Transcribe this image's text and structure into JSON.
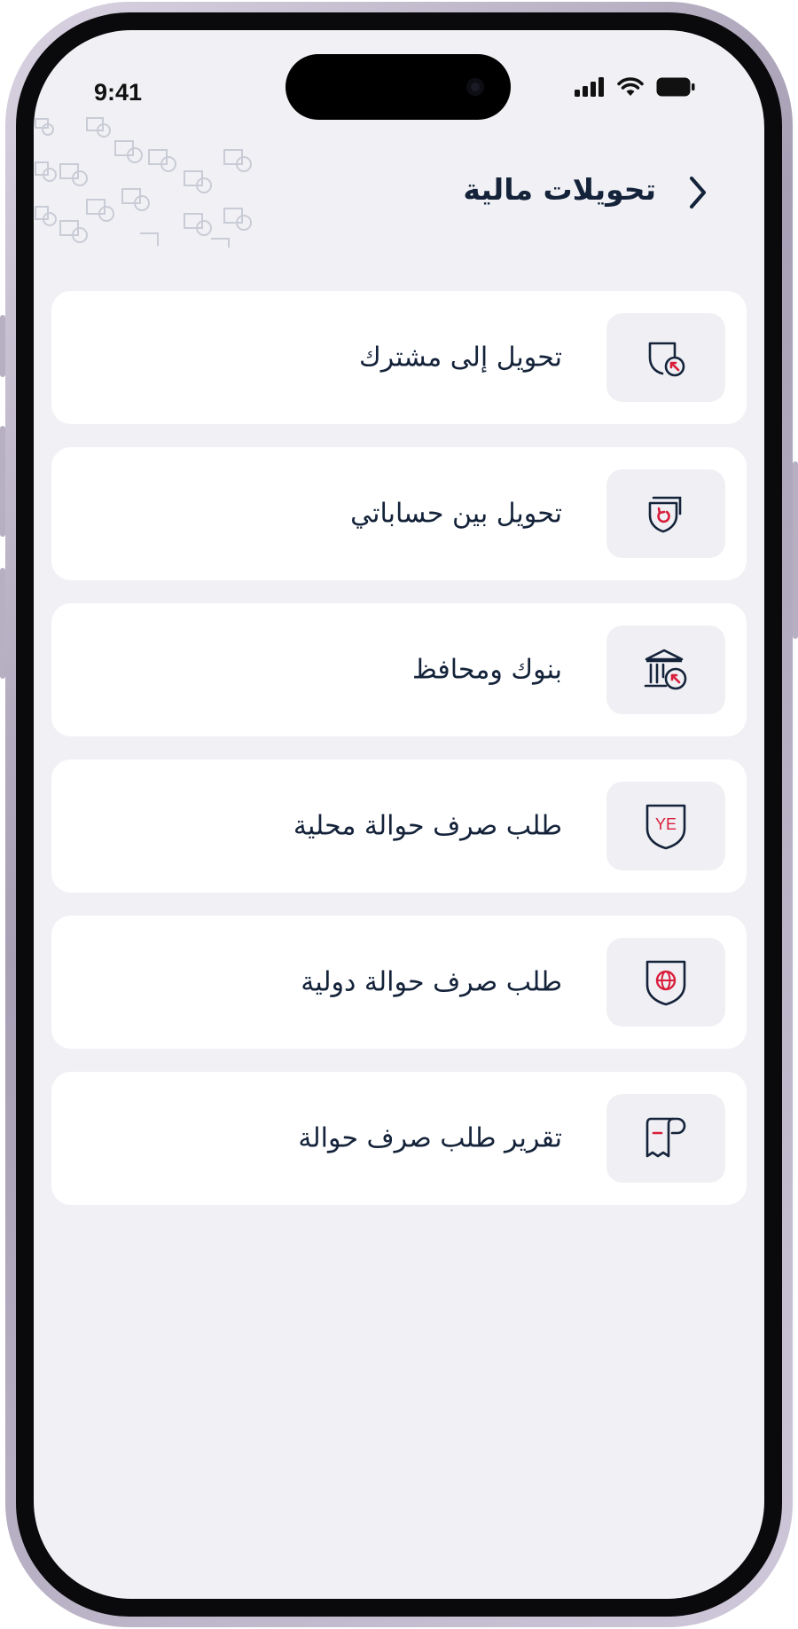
{
  "status_bar": {
    "time": "9:41"
  },
  "header": {
    "title": "تحويلات مالية",
    "back_icon": "chevron-right-icon"
  },
  "menu": {
    "items": [
      {
        "label": "تحويل إلى مشترك",
        "icon": "shield-transfer-arrow-icon"
      },
      {
        "label": "تحويل بين حساباتي",
        "icon": "shield-refresh-icon"
      },
      {
        "label": "بنوك ومحافظ",
        "icon": "bank-arrow-icon"
      },
      {
        "label": "طلب صرف حوالة محلية",
        "icon": "shield-ye-icon",
        "badge_text": "YE"
      },
      {
        "label": "طلب صرف حوالة دولية",
        "icon": "shield-globe-icon"
      },
      {
        "label": "تقرير طلب صرف حوالة",
        "icon": "receipt-report-icon"
      }
    ]
  },
  "colors": {
    "text": "#14233a",
    "accent": "#d81e3a",
    "background": "#f1f1f5",
    "card": "#ffffff",
    "icon_box": "#f0f0f4"
  }
}
